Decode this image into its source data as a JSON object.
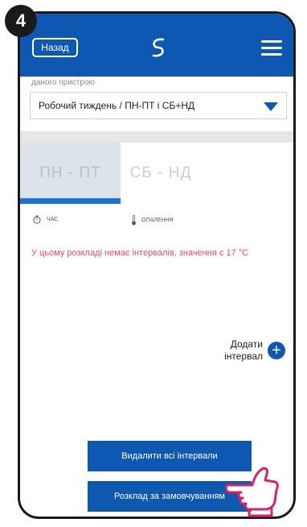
{
  "step": {
    "number": "4"
  },
  "header": {
    "back_label": "Назад",
    "logo": "brand-logo-icon",
    "menu": "hamburger-menu-icon"
  },
  "subtitle": "даного пристрою",
  "schedule_select": {
    "value": "Робочий тиждень / ПН-ПТ і СБ+НД"
  },
  "tabs": [
    {
      "label": "ПН - ПТ",
      "active": true
    },
    {
      "label": "СБ - НД",
      "active": false
    }
  ],
  "legend": {
    "time": "ЧАС",
    "heating": "ОПАЛЕННЯ"
  },
  "message": "У цьому розкладі немає інтервалів, значення є 17 °C",
  "add_interval": {
    "line1": "Додати",
    "line2": "інтервал"
  },
  "buttons": {
    "delete_all": "Видалити всі інтервали",
    "default_schedule": "Розклад за замовчуванням"
  },
  "colors": {
    "primary": "#0f58b2",
    "message": "#e84b6a",
    "tab_active": "#dde3ea"
  }
}
